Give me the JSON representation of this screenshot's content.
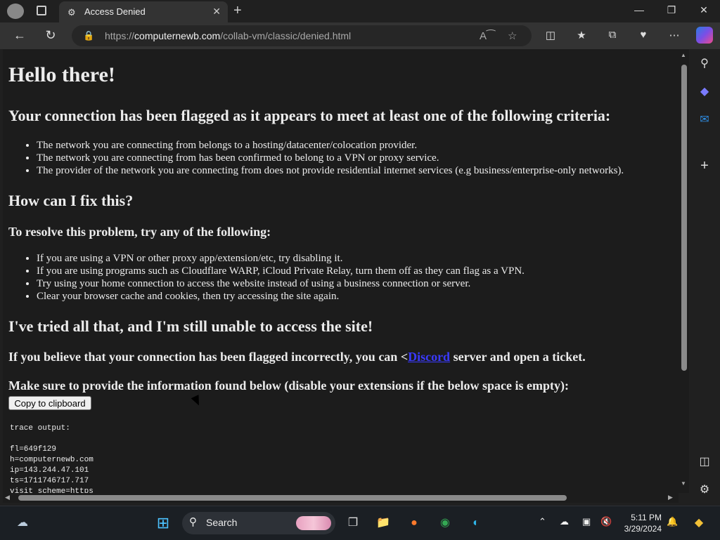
{
  "browser": {
    "tab_title": "Access Denied",
    "url_prefix": "https://",
    "url_host": "computernewb.com",
    "url_path": "/collab-vm/classic/denied.html"
  },
  "page": {
    "heading": "Hello there!",
    "flag_heading": "Your connection has been flagged as it appears to meet at least one of the following criteria:",
    "criteria": [
      "The network you are connecting from belongs to a hosting/datacenter/colocation provider.",
      "The network you are connecting from has been confirmed to belong to a VPN or proxy service.",
      "The provider of the network you are connecting from does not provide residential internet services (e.g business/enterprise-only networks)."
    ],
    "fix_heading": "How can I fix this?",
    "resolve_heading": "To resolve this problem, try any of the following:",
    "fixes": [
      "If you are using a VPN or other proxy app/extension/etc, try disabling it.",
      "If you are using programs such as Cloudflare WARP, iCloud Private Relay, turn them off as they can flag as a VPN.",
      "Try using your home connection to access the website instead of using a business connection or server.",
      "Clear your browser cache and cookies, then try accessing the site again."
    ],
    "tried_heading": "I've tried all that, and I'm still unable to access the site!",
    "ticket_before": "If you believe that your connection has been flagged incorrectly, you can <",
    "ticket_link": "Discord",
    "ticket_after": " server and open a ticket.",
    "provide_info": "Make sure to provide the information found below (disable your extensions if the below space is empty):",
    "copy_button": "Copy to clipboard",
    "trace_output": "trace output:\n\nfl=649f129\nh=computernewb.com\nip=143.244.47.101\nts=1711746717.717\nvisit_scheme=https"
  },
  "taskbar": {
    "search_label": "Search",
    "time": "5:11 PM",
    "date": "3/29/2024"
  }
}
